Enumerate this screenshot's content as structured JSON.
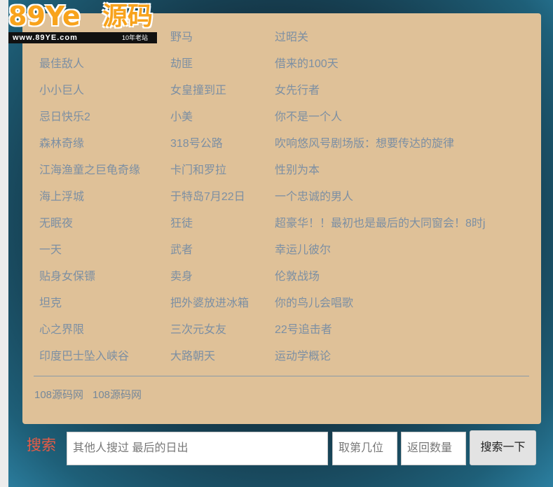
{
  "logo": {
    "text": "89Ye",
    "cn": "源码",
    "url": "www.89YE.com",
    "tag": "10年老站"
  },
  "movies": {
    "col1": [
      "",
      "最佳敌人",
      "小小巨人",
      "忌日快乐2",
      "森林奇缘",
      "江海渔童之巨龟奇缘",
      "海上浮城",
      "无眠夜",
      "一天",
      "贴身女保镖",
      "坦克",
      "心之界限",
      "印度巴士坠入峡谷"
    ],
    "col2": [
      "野马",
      "劫匪",
      "女皇撞到正",
      "小美",
      "318号公路",
      "卡门和罗拉",
      "于特岛7月22日",
      "狂徒",
      "武者",
      "卖身",
      "把外婆放进冰箱",
      "三次元女友",
      "大路朝天"
    ],
    "col3": [
      "过昭关",
      "借来的100天",
      "女先行者",
      "你不是一个人",
      "吹响悠风号剧场版：想要传达的旋律",
      "性别为本",
      "一个忠诚的男人",
      "超豪华！！最初也是最后的大同窗会！8时j",
      "幸运儿彼尔",
      "伦敦战场",
      "你的鸟儿会唱歌",
      "22号追击者",
      "运动学概论"
    ]
  },
  "footer": {
    "link1": "108源码网",
    "link2": "108源码网"
  },
  "search": {
    "label": "搜索",
    "query_placeholder": "其他人搜过 最后的日出",
    "position_placeholder": "取第几位",
    "count_placeholder": "返回数量",
    "button_label": "搜索一下"
  },
  "colors": {
    "panel_bg": "#dfc198",
    "link": "#7c8fa3",
    "search_label": "#ea5b45",
    "logo_orange": "#f8a31c"
  }
}
